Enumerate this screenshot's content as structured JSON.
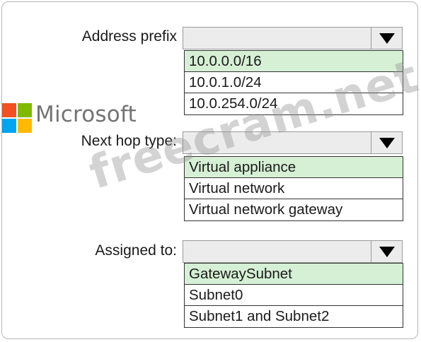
{
  "brand": {
    "name": "Microsoft",
    "logo_colors": [
      "#f25022",
      "#7fba00",
      "#00a4ef",
      "#ffb900"
    ]
  },
  "watermark": "freecram.net",
  "fields": [
    {
      "label": "Address prefix",
      "options": [
        "10.0.0.0/16",
        "10.0.1.0/24",
        "10.0.254.0/24"
      ],
      "selected_index": 0
    },
    {
      "label": "Next hop type:",
      "options": [
        "Virtual appliance",
        "Virtual network",
        "Virtual network gateway"
      ],
      "selected_index": 0
    },
    {
      "label": "Assigned to:",
      "options": [
        "GatewaySubnet",
        "Subnet0",
        "Subnet1 and Subnet2"
      ],
      "selected_index": 0
    }
  ],
  "colors": {
    "selected_option_bg": "#d6f0d5",
    "select_bg": "#ececec"
  }
}
